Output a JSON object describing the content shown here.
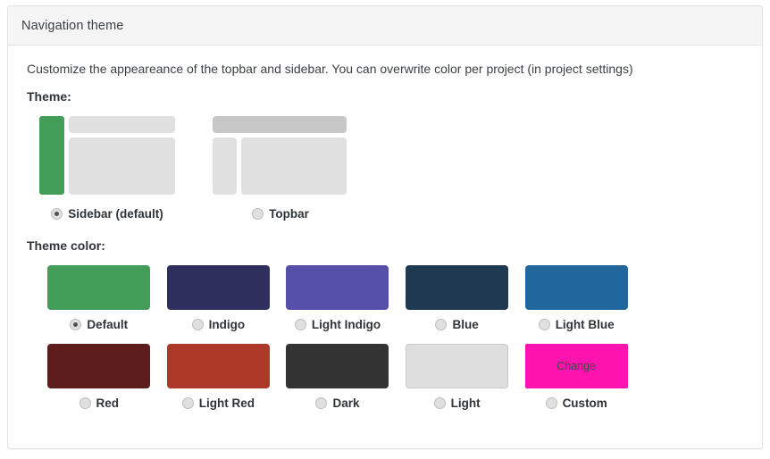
{
  "card": {
    "title": "Navigation theme",
    "description": "Customize the appeareance of the topbar and sidebar. You can overwrite color per project (in project settings)"
  },
  "theme": {
    "label": "Theme:",
    "options": [
      {
        "id": "sidebar",
        "label": "Sidebar (default)",
        "selected": true,
        "accent": "#419d58"
      },
      {
        "id": "topbar",
        "label": "Topbar",
        "selected": false
      }
    ]
  },
  "theme_color": {
    "label": "Theme color:",
    "options": [
      {
        "id": "default",
        "label": "Default",
        "color": "#419d58",
        "selected": true
      },
      {
        "id": "indigo",
        "label": "Indigo",
        "color": "#2e2f5c",
        "selected": false
      },
      {
        "id": "light-indigo",
        "label": "Light Indigo",
        "color": "#5650a8",
        "selected": false
      },
      {
        "id": "blue",
        "label": "Blue",
        "color": "#203a51",
        "selected": false
      },
      {
        "id": "light-blue",
        "label": "Light Blue",
        "color": "#21679e",
        "selected": false
      },
      {
        "id": "red",
        "label": "Red",
        "color": "#5e1d1d",
        "selected": false
      },
      {
        "id": "light-red",
        "label": "Light Red",
        "color": "#ae3828",
        "selected": false
      },
      {
        "id": "dark",
        "label": "Dark",
        "color": "#333333",
        "selected": false
      },
      {
        "id": "light",
        "label": "Light",
        "color": "#dedede",
        "selected": false,
        "border": "#c9c9c9"
      },
      {
        "id": "custom",
        "label": "Custom",
        "color": "#ff14b0",
        "selected": false,
        "button_label": "Change",
        "button_text_color": "#444444"
      }
    ]
  }
}
